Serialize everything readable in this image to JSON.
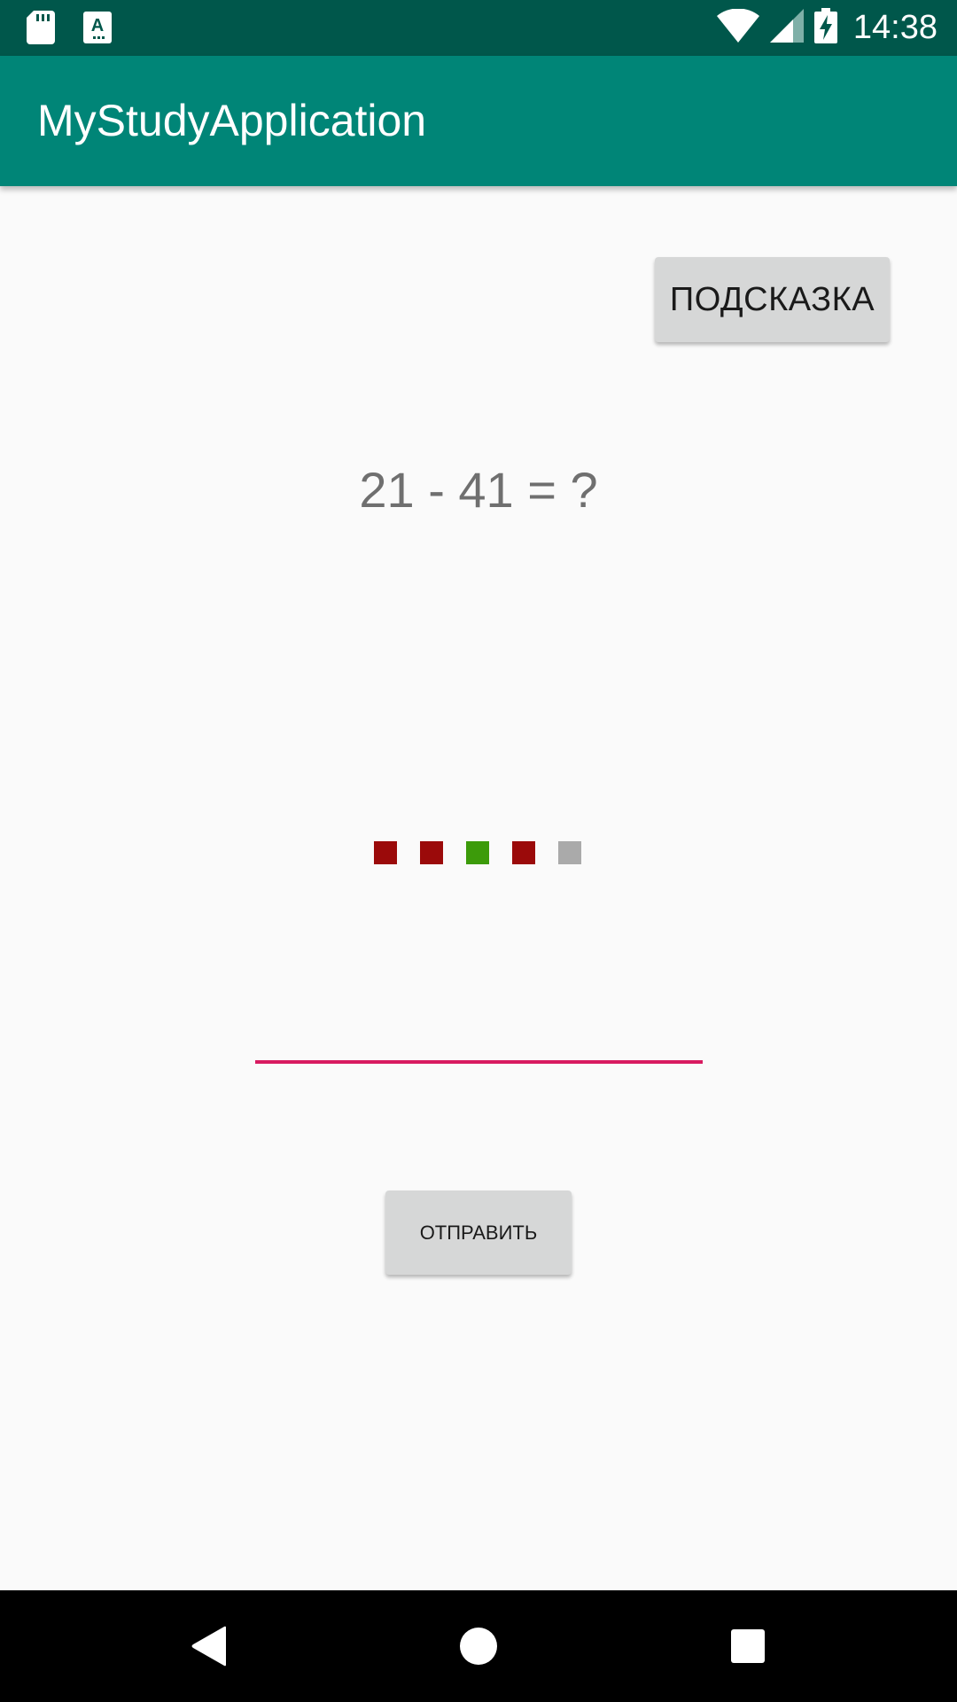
{
  "status_bar": {
    "time": "14:38",
    "icons": [
      "sd-card-icon",
      "keyboard-a-icon",
      "wifi-icon",
      "signal-icon",
      "battery-charging-icon"
    ],
    "background": "#00574b"
  },
  "app_bar": {
    "title": "MyStudyApplication",
    "background": "#008577"
  },
  "main": {
    "hint_button_label": "ПОДСКАЗКА",
    "equation": "21 - 41 = ?",
    "progress": [
      {
        "status": "wrong",
        "color": "#9b0a0a"
      },
      {
        "status": "wrong",
        "color": "#9b0a0a"
      },
      {
        "status": "correct",
        "color": "#3c9b0a"
      },
      {
        "status": "wrong",
        "color": "#9b0a0a"
      },
      {
        "status": "pending",
        "color": "#aaaaaa"
      }
    ],
    "answer_input": {
      "value": "",
      "placeholder": "",
      "underline_color": "#d81b60"
    },
    "send_button_label": "ОТПРАВИТЬ"
  },
  "nav_bar": {
    "buttons": [
      "back-icon",
      "home-icon",
      "recents-icon"
    ]
  }
}
